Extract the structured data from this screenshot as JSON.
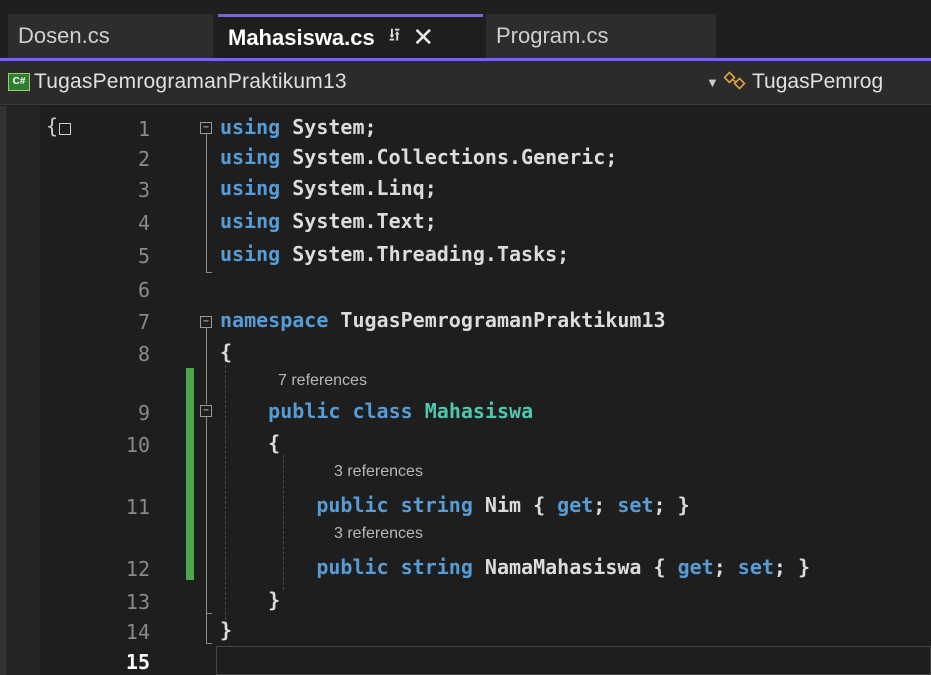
{
  "tabs": [
    {
      "label": "Dosen.cs",
      "active": false
    },
    {
      "label": "Mahasiswa.cs",
      "active": true,
      "pin_icon": "pin-icon",
      "close_icon": "close-icon"
    },
    {
      "label": "Program.cs",
      "active": false
    }
  ],
  "navbar": {
    "language_badge": "C#",
    "project": "TugasPemrogramanPraktikum13",
    "class_icon": "class-icon",
    "class_name": "TugasPemrog"
  },
  "colors": {
    "accent": "#7b66d9",
    "keyword": "#569cd6",
    "type": "#4ec9b0",
    "change_bar": "#4ca64c"
  },
  "lines": [
    {
      "num": "1",
      "code": "using System;"
    },
    {
      "num": "2",
      "code": "using System.Collections.Generic;"
    },
    {
      "num": "3",
      "code": "using System.Linq;"
    },
    {
      "num": "4",
      "code": "using System.Text;"
    },
    {
      "num": "5",
      "code": "using System.Threading.Tasks;"
    },
    {
      "num": "6",
      "code": ""
    },
    {
      "num": "7",
      "code": "namespace TugasPemrogramanPraktikum13"
    },
    {
      "num": "8",
      "code": "{"
    },
    {
      "num": "9",
      "code": "    public class Mahasiswa",
      "lens": "7 references"
    },
    {
      "num": "10",
      "code": "    {"
    },
    {
      "num": "11",
      "code": "        public string Nim { get; set; }",
      "lens": "3 references"
    },
    {
      "num": "12",
      "code": "        public string NamaMahasiswa { get; set; }",
      "lens": "3 references"
    },
    {
      "num": "13",
      "code": "    }"
    },
    {
      "num": "14",
      "code": "}"
    },
    {
      "num": "15",
      "code": "",
      "current": true
    }
  ]
}
